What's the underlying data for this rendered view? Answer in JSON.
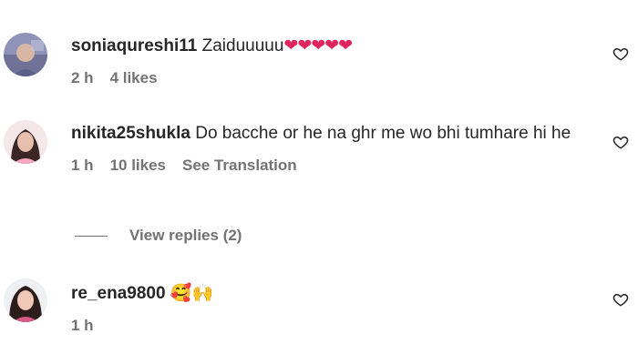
{
  "comments": [
    {
      "username": "soniaqureshi11",
      "text": "Zaiduuuuu",
      "emoji": "❤❤❤❤❤",
      "time": "2 h",
      "likes": "4 likes"
    },
    {
      "username": "nikita25shukla",
      "text": "Do bacche or he na ghr me wo bhi tumhare hi he",
      "emoji": "",
      "time": "1 h",
      "likes": "10 likes",
      "translate": "See Translation",
      "view_replies": "View replies (2)"
    },
    {
      "username": "re_ena9800",
      "text": "",
      "emoji": "🥰🙌",
      "time": "1 h"
    }
  ],
  "icons": {
    "like": "heart-outline-icon"
  },
  "colors": {
    "meta_text": "#737373",
    "text": "#262626",
    "heart_red": "#e0245e"
  }
}
